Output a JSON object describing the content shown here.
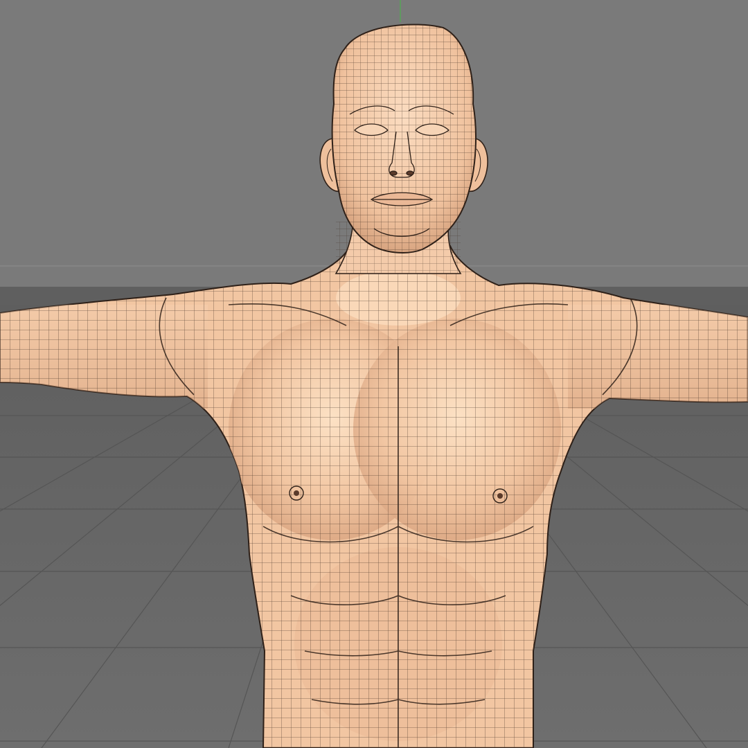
{
  "viewport": {
    "background_color": "#7a7a7a",
    "floor_color": "#6a6a6a",
    "floor_grid_color": "#585858",
    "horizon_band_color": "#5f5f5f",
    "horizon_line_color": "#8e8e8e",
    "y_axis_color": "#4fae4f"
  },
  "model": {
    "skin_color": "#f2c6a2",
    "skin_highlight_color": "#fde4c8",
    "skin_shadow_color": "#c99474",
    "wireframe_color": "#3a2a20",
    "display_mode": "shaded-with-wireframe",
    "pose": "t-pose"
  }
}
